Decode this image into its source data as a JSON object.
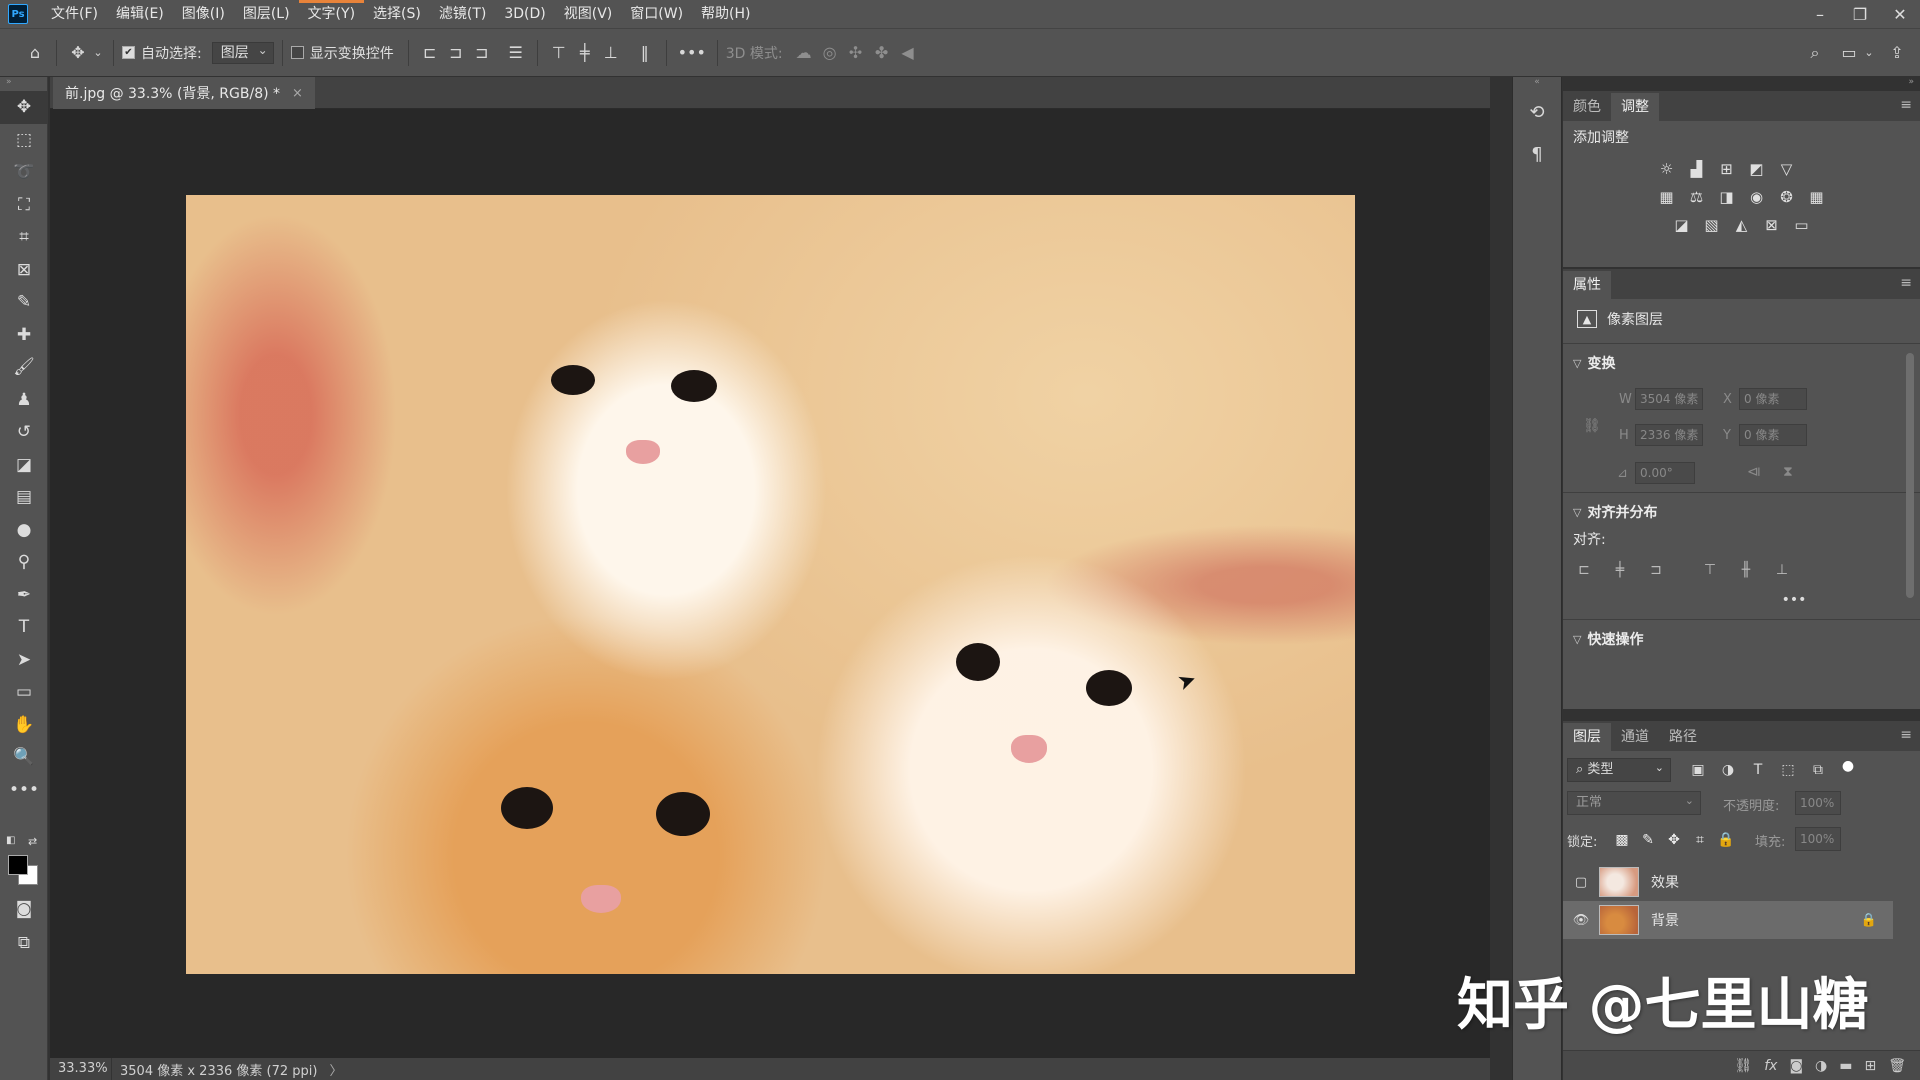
{
  "menubar": {
    "logo": "Ps",
    "items": [
      "文件(F)",
      "编辑(E)",
      "图像(I)",
      "图层(L)",
      "文字(Y)",
      "选择(S)",
      "滤镜(T)",
      "3D(D)",
      "视图(V)",
      "窗口(W)",
      "帮助(H)"
    ],
    "highlighted_index": 4
  },
  "optionsbar": {
    "auto_select_label": "自动选择:",
    "auto_select_checked": true,
    "auto_select_target": "图层",
    "show_transform_label": "显示变换控件",
    "show_transform_checked": false,
    "more_label": "•••",
    "mode_3d_label": "3D 模式:"
  },
  "document": {
    "tab_title": "前.jpg @ 33.3% (背景, RGB/8) *",
    "close_label": "×",
    "zoom": "33.33%",
    "dimensions_info": "3504 像素 x 2336 像素 (72 ppi)",
    "status_arrow": "〉"
  },
  "panels": {
    "top_tabs": [
      "颜色",
      "调整"
    ],
    "top_active": 1,
    "add_adjustment": "添加调整",
    "properties_tab": "属性",
    "pixel_layer": "像素图层",
    "transform_section": "变换",
    "w_label": "W",
    "w_value": "3504 像素",
    "x_label": "X",
    "x_value": "0 像素",
    "h_label": "H",
    "h_value": "2336 像素",
    "y_label": "Y",
    "y_value": "0 像素",
    "angle_value": "0.00°",
    "align_section": "对齐并分布",
    "align_label": "对齐:",
    "align_more": "•••",
    "quick_actions": "快速操作",
    "layer_tabs": [
      "图层",
      "通道",
      "路径"
    ],
    "layer_filter": "类型",
    "blend_mode": "正常",
    "opacity_label": "不透明度:",
    "opacity_value": "100%",
    "lock_label": "锁定:",
    "fill_label": "填充:",
    "fill_value": "100%",
    "layers": [
      {
        "name": "效果",
        "visible": false,
        "locked": false
      },
      {
        "name": "背景",
        "visible": true,
        "locked": true
      }
    ]
  },
  "watermark": "知乎 @七里山糖",
  "colors": {
    "chrome": "#535353",
    "canvas_bg": "#282828",
    "foreground_swatch": "#000000",
    "background_swatch": "#ffffff",
    "menu_highlight": "#e8833a"
  }
}
